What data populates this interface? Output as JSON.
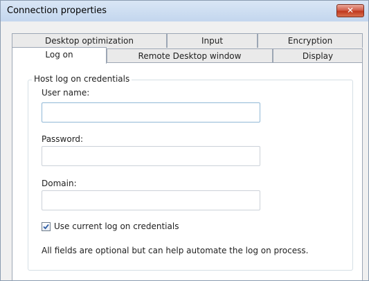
{
  "window": {
    "title": "Connection properties",
    "close_glyph": "✕",
    "close_icon": "close-icon"
  },
  "tabs": {
    "row1": [
      {
        "label": "Desktop optimization"
      },
      {
        "label": "Input"
      },
      {
        "label": "Encryption"
      }
    ],
    "row2": [
      {
        "label": "Log on",
        "selected": true
      },
      {
        "label": "Remote Desktop window"
      },
      {
        "label": "Display"
      }
    ]
  },
  "credentials": {
    "group_title": "Host log on credentials",
    "username_label": "User name:",
    "username_value": "",
    "password_label": "Password:",
    "password_value": "",
    "domain_label": "Domain:",
    "domain_value": "",
    "use_current_label": "Use current log on credentials",
    "use_current_checked": true,
    "help_text": "All fields are optional but can help automate the log on process."
  },
  "colors": {
    "accent": "#2f5ea6",
    "close_button": "#c0391f",
    "titlebar": "#c3d6ee"
  }
}
